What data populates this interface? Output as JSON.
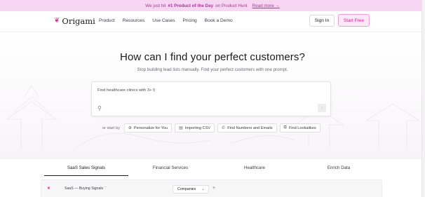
{
  "banner": {
    "prefix": "We just hit",
    "highlight": "#1 Product of the Day",
    "suffix": "on Product Hunt",
    "link": "Read more →"
  },
  "nav": {
    "brand": "Origami",
    "items": [
      "Product",
      "Resources",
      "Use Cases",
      "Pricing",
      "Book a Demo"
    ],
    "sign_in": "Sign In",
    "start_free": "Start Free"
  },
  "hero": {
    "title": "How can I find your perfect customers?",
    "subtitle": "Stop building lead lists manually. Find your perfect customers with one prompt."
  },
  "prompt": {
    "placeholder": "Find healthcare clinics with 3+ l|"
  },
  "starters": {
    "lead": "or start by",
    "chips": [
      {
        "icon": "globe-icon",
        "label": "Personalize for You"
      },
      {
        "icon": "file-icon",
        "label": "Importing CSV"
      },
      {
        "icon": "phone-icon",
        "label": "Find Numbers and Emails"
      },
      {
        "icon": "lookalike-icon",
        "label": "Find Lookalikes"
      }
    ]
  },
  "tabs": [
    "SaaS Sales Signals",
    "Financial Services",
    "Healthcare",
    "Enrich Data"
  ],
  "panel": {
    "title": "SaaS — Buying Signals",
    "dots": "···",
    "select": "Companies",
    "plus": "+"
  },
  "colors": {
    "accent": "#d23d8e",
    "banner_bg": "#f7d6f4",
    "cta_bg": "#fde8f6"
  }
}
